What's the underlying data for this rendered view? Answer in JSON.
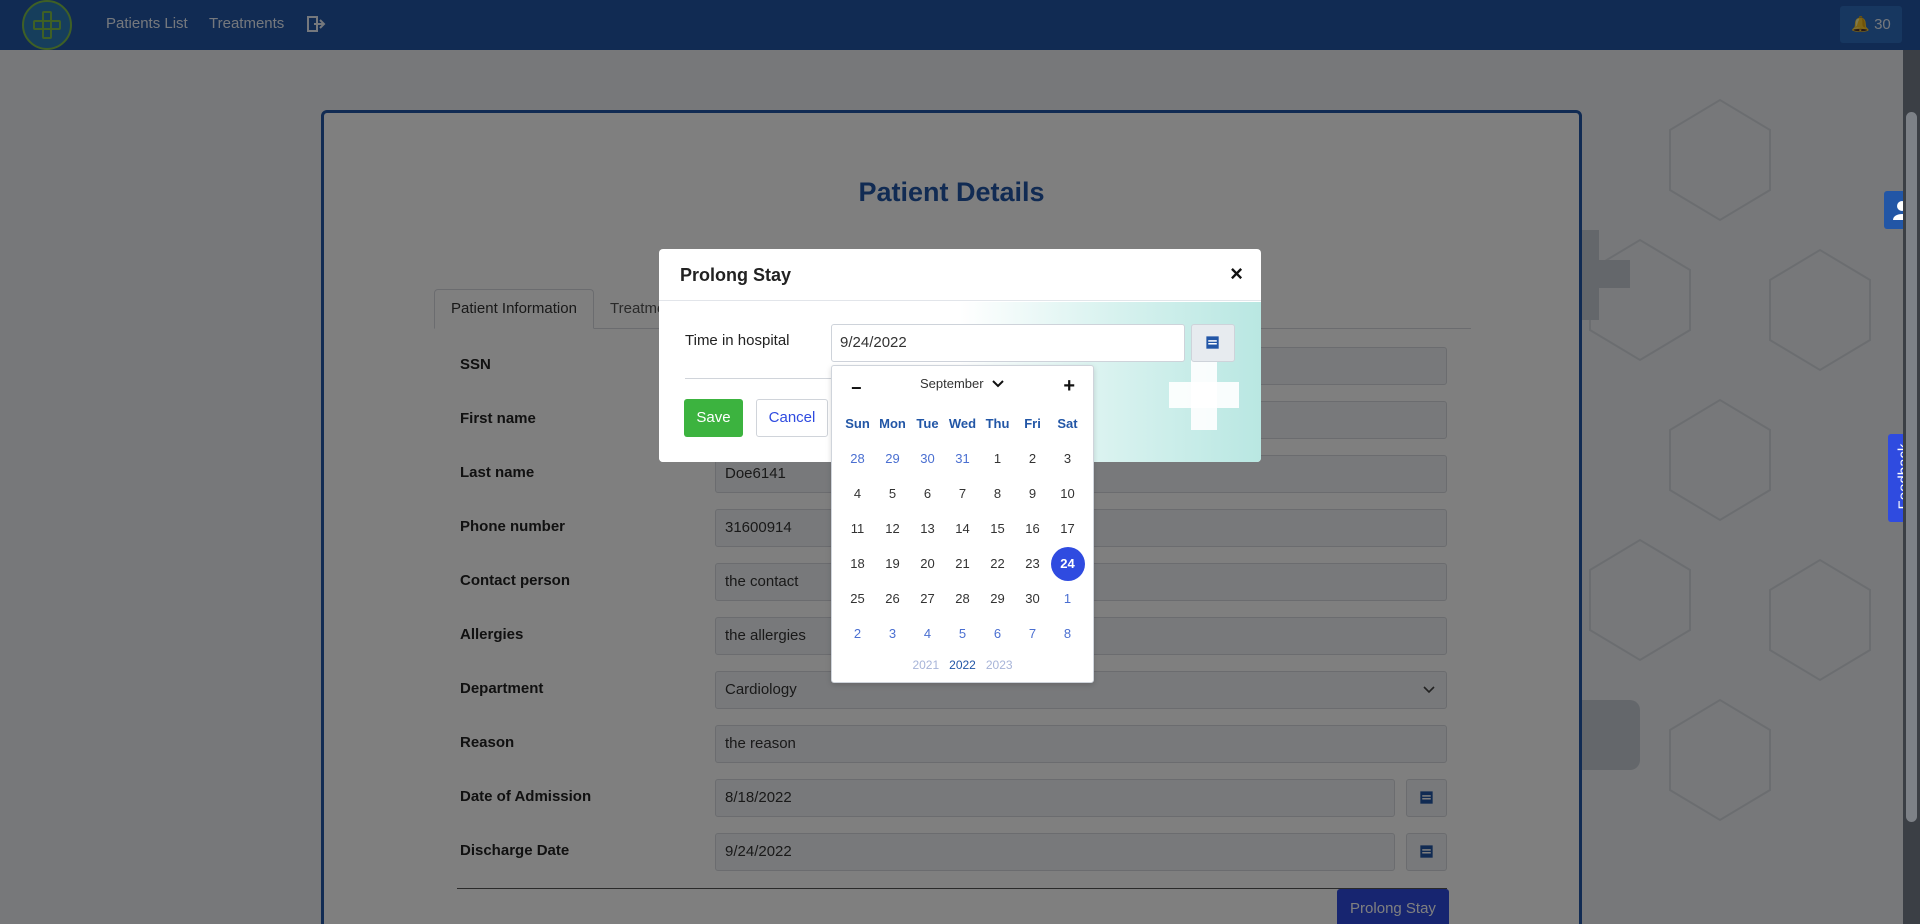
{
  "navbar": {
    "links": [
      "Patients List",
      "Treatments"
    ],
    "notifications_count": "30",
    "colors": {
      "bar": "#2256a6",
      "button": "#2e6fc0"
    }
  },
  "page": {
    "title": "Patient Details",
    "tabs": [
      "Patient Information",
      "Treatme"
    ],
    "fields": [
      {
        "label": "SSN",
        "value": ""
      },
      {
        "label": "First name",
        "value": ""
      },
      {
        "label": "Last name",
        "value": "Doe6141"
      },
      {
        "label": "Phone number",
        "value": "31600914"
      },
      {
        "label": "Contact person",
        "value": "the contact"
      },
      {
        "label": "Allergies",
        "value": "the allergies"
      },
      {
        "label": "Department",
        "value": "Cardiology"
      },
      {
        "label": "Reason",
        "value": "the reason"
      },
      {
        "label": "Date of Admission",
        "value": "8/18/2022"
      },
      {
        "label": "Discharge Date",
        "value": "9/24/2022"
      }
    ],
    "prolong_button": "Prolong Stay"
  },
  "side": {
    "feedback_label": "Feedback"
  },
  "modal": {
    "title": "Prolong Stay",
    "close": "×",
    "label": "Time in hospital",
    "value": "9/24/2022",
    "save": "Save",
    "cancel": "Cancel"
  },
  "datepicker": {
    "prev": "−",
    "next": "+",
    "month": "September",
    "weekdays": [
      "Sun",
      "Mon",
      "Tue",
      "Wed",
      "Thu",
      "Fri",
      "Sat"
    ],
    "weeks": [
      [
        {
          "d": "28",
          "m": true
        },
        {
          "d": "29",
          "m": true
        },
        {
          "d": "30",
          "m": true
        },
        {
          "d": "31",
          "m": true
        },
        {
          "d": "1"
        },
        {
          "d": "2"
        },
        {
          "d": "3"
        }
      ],
      [
        {
          "d": "4"
        },
        {
          "d": "5"
        },
        {
          "d": "6"
        },
        {
          "d": "7"
        },
        {
          "d": "8"
        },
        {
          "d": "9"
        },
        {
          "d": "10"
        }
      ],
      [
        {
          "d": "11"
        },
        {
          "d": "12"
        },
        {
          "d": "13"
        },
        {
          "d": "14"
        },
        {
          "d": "15"
        },
        {
          "d": "16"
        },
        {
          "d": "17"
        }
      ],
      [
        {
          "d": "18"
        },
        {
          "d": "19"
        },
        {
          "d": "20"
        },
        {
          "d": "21"
        },
        {
          "d": "22"
        },
        {
          "d": "23"
        },
        {
          "d": "24",
          "s": true
        }
      ],
      [
        {
          "d": "25"
        },
        {
          "d": "26"
        },
        {
          "d": "27"
        },
        {
          "d": "28"
        },
        {
          "d": "29"
        },
        {
          "d": "30"
        },
        {
          "d": "1",
          "m": true
        }
      ],
      [
        {
          "d": "2",
          "m": true
        },
        {
          "d": "3",
          "m": true
        },
        {
          "d": "4",
          "m": true
        },
        {
          "d": "5",
          "m": true
        },
        {
          "d": "6",
          "m": true
        },
        {
          "d": "7",
          "m": true
        },
        {
          "d": "8",
          "m": true
        }
      ]
    ],
    "years": [
      "2021",
      "2022",
      "2023"
    ],
    "current_year": "2022",
    "accent": "#2f4be0"
  }
}
